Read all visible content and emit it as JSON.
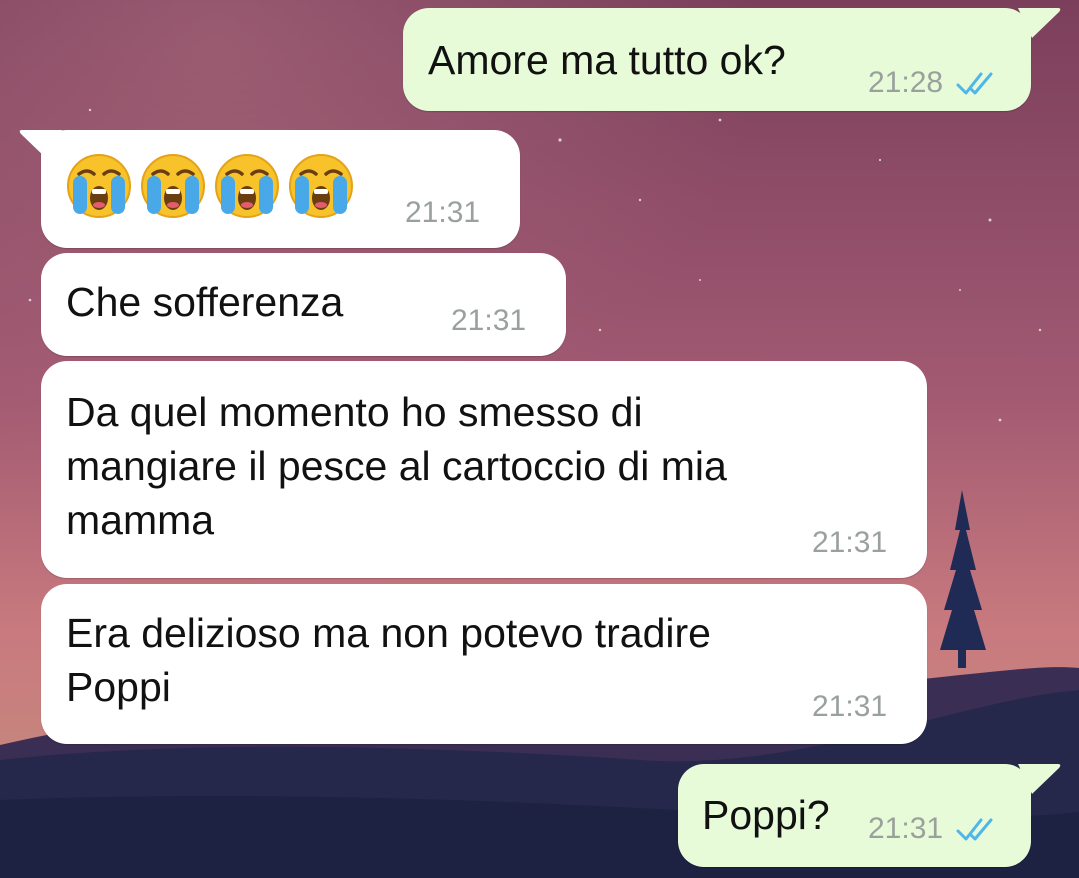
{
  "chat": {
    "messages": [
      {
        "id": "m1",
        "direction": "outgoing",
        "text": "Amore ma tutto ok?",
        "time": "21:28",
        "status": "read"
      },
      {
        "id": "m2",
        "direction": "incoming",
        "emoji": [
          "loudly-crying-face",
          "loudly-crying-face",
          "loudly-crying-face",
          "loudly-crying-face"
        ],
        "time": "21:31"
      },
      {
        "id": "m3",
        "direction": "incoming",
        "text": "Che sofferenza",
        "time": "21:31"
      },
      {
        "id": "m4",
        "direction": "incoming",
        "text": "Da quel momento ho smesso di\nmangiare il pesce al cartoccio di mia\nmamma",
        "time": "21:31"
      },
      {
        "id": "m5",
        "direction": "incoming",
        "text": "Era delizioso ma non potevo tradire\nPoppi",
        "time": "21:31"
      },
      {
        "id": "m6",
        "direction": "outgoing",
        "text": "Poppi?",
        "time": "21:31",
        "status": "read"
      }
    ]
  },
  "colors": {
    "incoming_bubble": "#ffffff",
    "outgoing_bubble": "#e7fbd9",
    "timestamp": "#9aa19c",
    "read_check": "#4fb6ec"
  },
  "icons": {
    "read_receipt": "double-check-icon",
    "emoji": "loudly-crying-face-emoji"
  }
}
